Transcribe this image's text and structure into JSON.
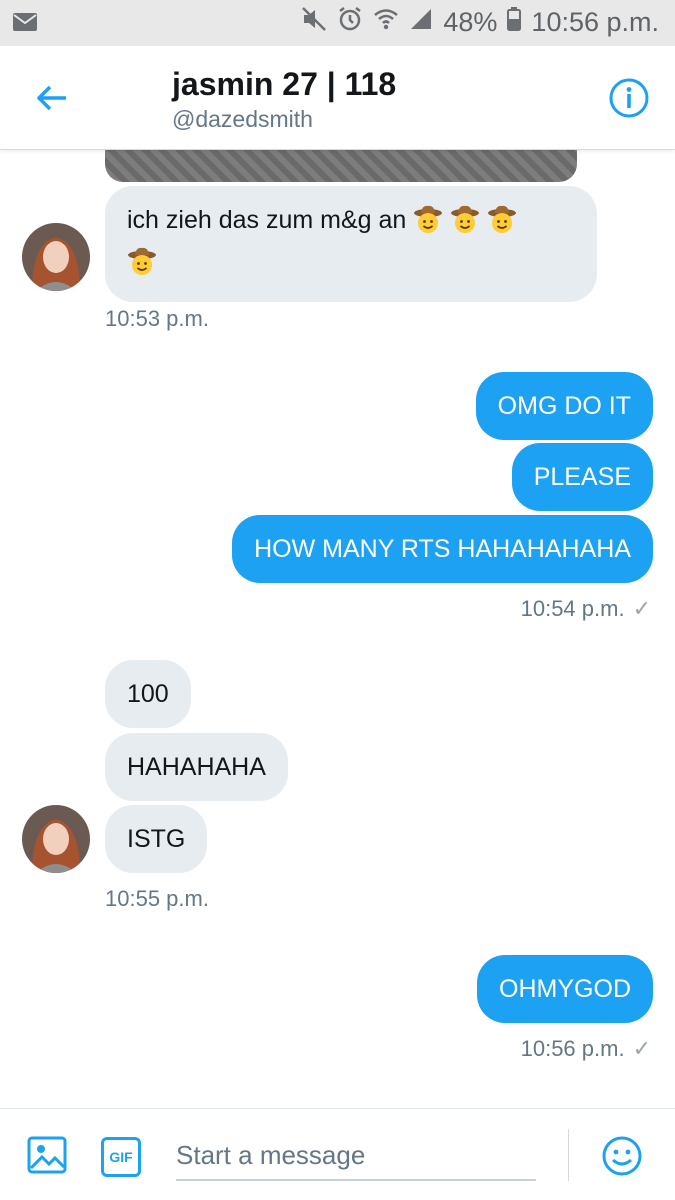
{
  "status_bar": {
    "battery": "48%",
    "time": "10:56 p.m."
  },
  "header": {
    "title": "jasmin 27 | 118",
    "handle": "@dazedsmith"
  },
  "messages": {
    "m1": {
      "text": "ich zieh das zum m&g an",
      "emoji": "🤠"
    },
    "t1": "10:53 p.m.",
    "m2": "OMG DO IT",
    "m3": "PLEASE",
    "m4": "HOW MANY RTS HAHAHAHAHA",
    "t2": "10:54 p.m.",
    "m5": "100",
    "m6": "HAHAHAHA",
    "m7": "ISTG",
    "t3": "10:55 p.m.",
    "m8": "OHMYGOD",
    "t4": "10:56 p.m."
  },
  "composer": {
    "gif_label": "GIF",
    "placeholder": "Start a message"
  },
  "colors": {
    "accent": "#1da1f2",
    "incoming_bubble": "#e6ecf0",
    "muted_text": "#657786"
  },
  "icons": [
    "mail-icon",
    "mute-icon",
    "alarm-icon",
    "wifi-icon",
    "signal-icon",
    "battery-icon",
    "back-arrow-icon",
    "info-icon",
    "image-icon",
    "gif-icon",
    "emoji-icon"
  ]
}
